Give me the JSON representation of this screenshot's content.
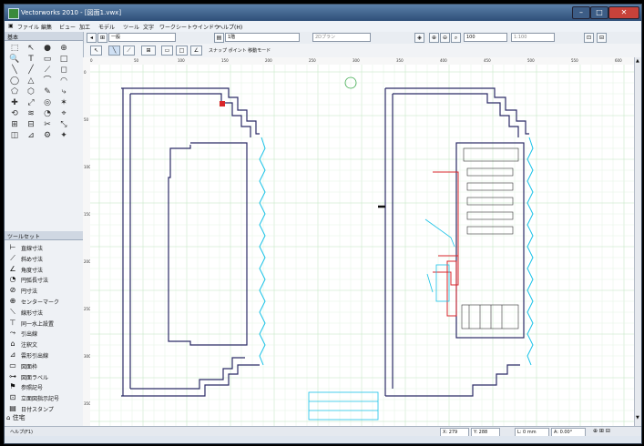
{
  "window": {
    "title": "Vectorworks 2010 - [図面1.vwx]",
    "min_label": "–",
    "max_label": "□",
    "close_label": "✕"
  },
  "menubar": {
    "items": [
      "ファイル",
      "編集",
      "ビュー",
      "加工",
      "モデル",
      "ツール",
      "文字",
      "ワークシート",
      "ウインドウ",
      "ヘルプ(H)"
    ]
  },
  "viewbar": {
    "class_value": "一般",
    "layer_value": "1階",
    "view_value": "2Dプラン",
    "zoom_value": "100",
    "scale_value": "1:100"
  },
  "modebar": {
    "mode_text": "スナップ ポイント 移動モード"
  },
  "basic_palette": {
    "title": "基本",
    "tools": [
      "⬚",
      "↖",
      "●",
      "⊕",
      "🔍",
      "T",
      "▭",
      "□",
      "╲",
      "╱",
      "⟋",
      "◻",
      "◯",
      "△",
      "⌒",
      "◠",
      "⬠",
      "⬡",
      "✎",
      "⤷",
      "✚",
      "⤢",
      "◎",
      "✶",
      "⟲",
      "≋",
      "◔",
      "⌖",
      "⊞",
      "⊟",
      "✂",
      "⤡",
      "◫",
      "⊿",
      "⚙",
      "✦"
    ]
  },
  "toolset_palette": {
    "title": "ツールセット",
    "items": [
      {
        "icon": "⊢",
        "label": "直線寸法"
      },
      {
        "icon": "⟋",
        "label": "斜め寸法"
      },
      {
        "icon": "∠",
        "label": "角度寸法"
      },
      {
        "icon": "◔",
        "label": "円弧長寸法"
      },
      {
        "icon": "⊘",
        "label": "円寸法"
      },
      {
        "icon": "⊕",
        "label": "センターマーク"
      },
      {
        "icon": "⟍",
        "label": "線形寸法"
      },
      {
        "icon": "⊤",
        "label": "同一水上設置"
      },
      {
        "icon": "⤳",
        "label": "引出線"
      },
      {
        "icon": "⌂",
        "label": "注釈文"
      },
      {
        "icon": "⊿",
        "label": "雲形引出線"
      },
      {
        "icon": "▭",
        "label": "図面枠"
      },
      {
        "icon": "⊶",
        "label": "図面ラベル"
      },
      {
        "icon": "⚑",
        "label": "参照記号"
      },
      {
        "icon": "⊡",
        "label": "立面図指示記号"
      },
      {
        "icon": "▤",
        "label": "日付スタンプ"
      }
    ],
    "footer_label": "⌂ 住宅"
  },
  "ruler": {
    "h_ticks": [
      "0",
      "50",
      "100",
      "150",
      "200",
      "250",
      "300",
      "350",
      "400",
      "450",
      "500",
      "550",
      "600"
    ],
    "v_ticks": [
      "0",
      "50",
      "100",
      "150",
      "200",
      "250",
      "300",
      "350"
    ]
  },
  "statusbar": {
    "left_text": "ヘルプ(F1)",
    "x": "X: 279",
    "y": "Y: 288",
    "l": "L: 0 mm",
    "a": "A: 0.00°",
    "icons": "⊕ ⊞ ⊟"
  },
  "colors": {
    "wall": "#2b2b66",
    "grid": "#b9e3b9",
    "cyan": "#19c2e8",
    "red": "#d9262b",
    "title_top": "#5a7fa8"
  }
}
